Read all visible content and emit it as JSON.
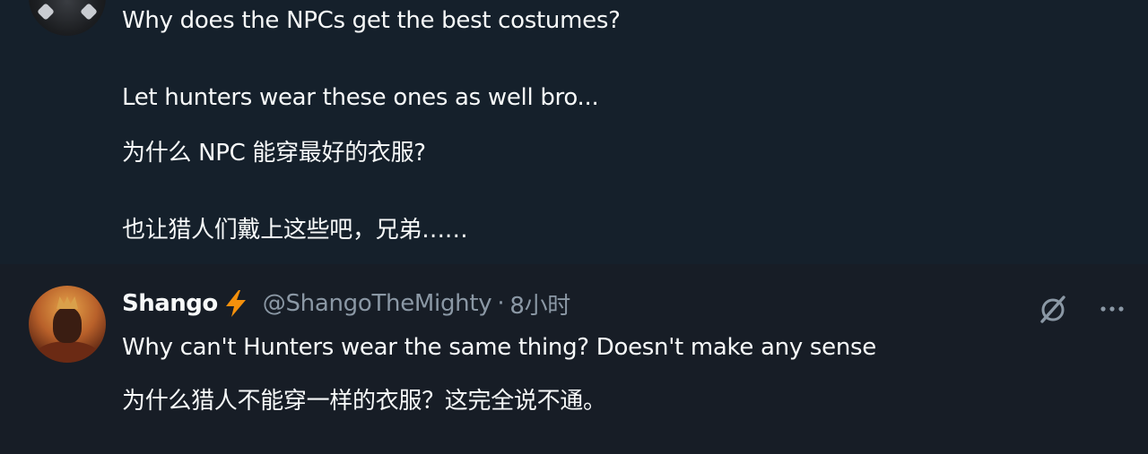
{
  "tweet1": {
    "line1": "Why does the NPCs get the best costumes?",
    "line2": "Let hunters wear these ones as well bro...",
    "line3": "为什么 NPC 能穿最好的衣服?",
    "line4": "也让猎人们戴上这些吧，兄弟……"
  },
  "tweet2": {
    "name": "Shango",
    "handle": "@ShangoTheMighty",
    "separator": "·",
    "time": "8小时",
    "line1": "Why can't Hunters wear the same thing? Doesn't make any sense",
    "line2": "为什么猎人不能穿一样的衣服？这完全说不通。",
    "verified_icon": "lightning-bolt-icon",
    "accent_color": "#f4900c"
  },
  "colors": {
    "background": "#15202b",
    "text_primary": "#f7f9f9",
    "text_secondary": "#8b98a5"
  }
}
